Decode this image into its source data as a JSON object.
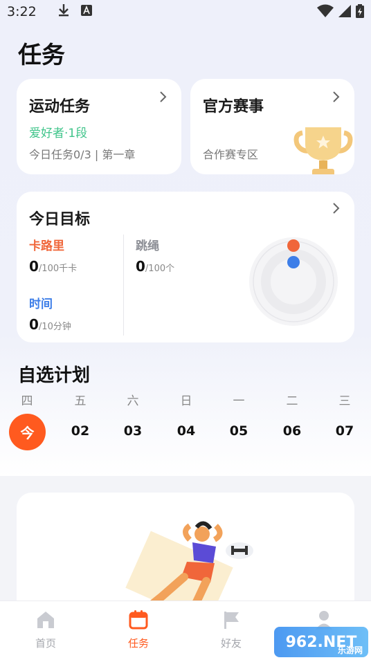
{
  "status_bar": {
    "time": "3:22"
  },
  "page": {
    "title": "任务"
  },
  "sport_task": {
    "title": "运动任务",
    "level": "爱好者·1段",
    "progress": "今日任务0/3 | 第一章"
  },
  "official_match": {
    "title": "官方赛事",
    "subtitle": "合作赛专区"
  },
  "daily_goal": {
    "title": "今日目标",
    "calories": {
      "label": "卡路里",
      "value": "0",
      "unit": "/100千卡",
      "color": "#f0663a"
    },
    "rope": {
      "label": "跳绳",
      "value": "0",
      "unit": "/100个",
      "color": "#8d8f96"
    },
    "time": {
      "label": "时间",
      "value": "0",
      "unit": "/10分钟",
      "color": "#3d7ee8"
    }
  },
  "custom_plan": {
    "title": "自选计划",
    "weekdays": [
      "四",
      "五",
      "六",
      "日",
      "一",
      "二",
      "三"
    ],
    "dates": [
      "今",
      "02",
      "03",
      "04",
      "05",
      "06",
      "07"
    ]
  },
  "tab_bar": {
    "items": [
      {
        "label": "首页",
        "icon": "home-icon"
      },
      {
        "label": "任务",
        "icon": "calendar-icon"
      },
      {
        "label": "好友",
        "icon": "flag-icon"
      },
      {
        "label": "",
        "icon": "user-icon"
      }
    ],
    "active_color": "#ff5a1f"
  },
  "watermark": {
    "brand": "962.NET",
    "sub": "乐游网"
  }
}
